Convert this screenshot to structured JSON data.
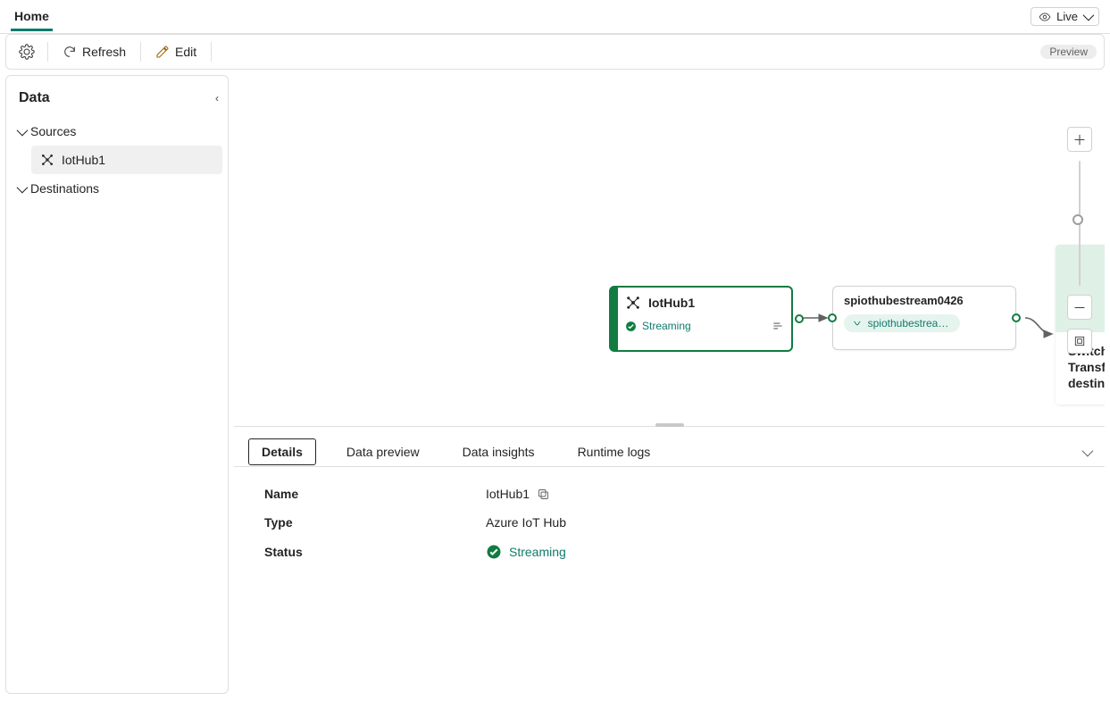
{
  "topTabs": {
    "home": "Home"
  },
  "liveDropdown": {
    "label": "Live"
  },
  "toolbar": {
    "refresh": "Refresh",
    "edit": "Edit",
    "previewBadge": "Preview"
  },
  "sidePanel": {
    "title": "Data",
    "sources": {
      "header": "Sources",
      "items": [
        {
          "name": "IotHub1"
        }
      ]
    },
    "destinations": {
      "header": "Destinations"
    }
  },
  "canvas": {
    "iothubNode": {
      "title": "IotHub1",
      "status": "Streaming"
    },
    "streamNode": {
      "title": "spiothubestream0426",
      "pill": "spiothubestream0..."
    },
    "placeholderNode": {
      "text": "Switch to edit mode to Transform event or add destination"
    }
  },
  "bottomPanel": {
    "tabs": {
      "details": "Details",
      "dataPreview": "Data preview",
      "dataInsights": "Data insights",
      "runtimeLogs": "Runtime logs"
    },
    "details": {
      "nameLabel": "Name",
      "nameValue": "IotHub1",
      "typeLabel": "Type",
      "typeValue": "Azure IoT Hub",
      "statusLabel": "Status",
      "statusValue": "Streaming"
    }
  }
}
